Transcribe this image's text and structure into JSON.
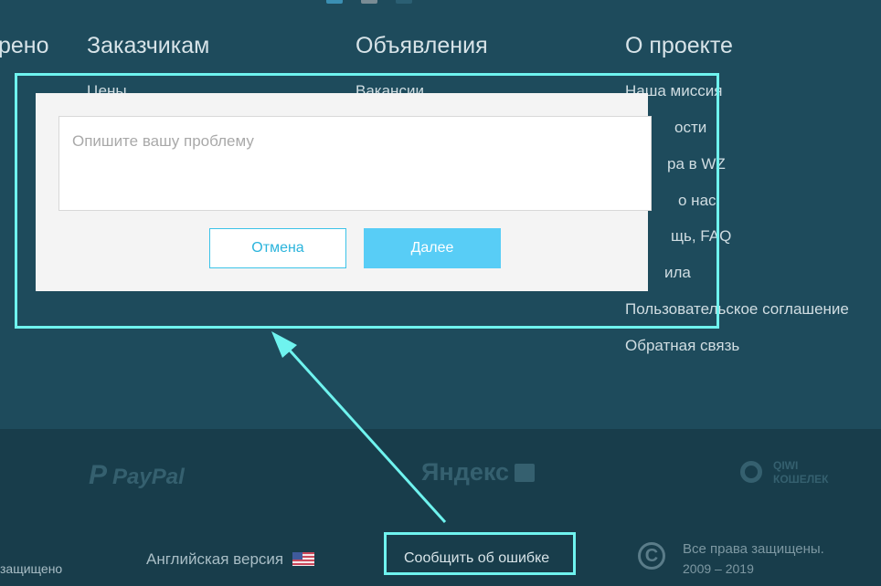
{
  "columns": [
    {
      "heading": "рено",
      "links": []
    },
    {
      "heading": "Заказчикам",
      "links": [
        "Цены"
      ]
    },
    {
      "heading": "Объявления",
      "links": [
        "Вакансии"
      ]
    },
    {
      "heading": "О проекте",
      "links": [
        "Наша миссия",
        "ости",
        "ра в WZ",
        "о нас",
        "щь, FAQ",
        "ила",
        "Пользовательское соглашение",
        "Обратная связь"
      ]
    }
  ],
  "footer": {
    "payments": {
      "paypal": "PayPal",
      "yandex": "Яндекс",
      "qiwi_top": "QIWI",
      "qiwi_bottom": "КОШЕЛЕК"
    },
    "left_fragment": "защищено",
    "english_version": "Английская версия",
    "report_error": "Сообщить об ошибке",
    "rights": "Все права защищены.",
    "years": "2009 – 2019"
  },
  "modal": {
    "textarea_placeholder": "Опишите вашу проблему",
    "cancel_label": "Отмена",
    "next_label": "Далее"
  },
  "colors": {
    "background": "#1e4b5c",
    "footer_background": "#183d4b",
    "highlight": "#6ff3ef",
    "accent": "#58cdf6"
  }
}
